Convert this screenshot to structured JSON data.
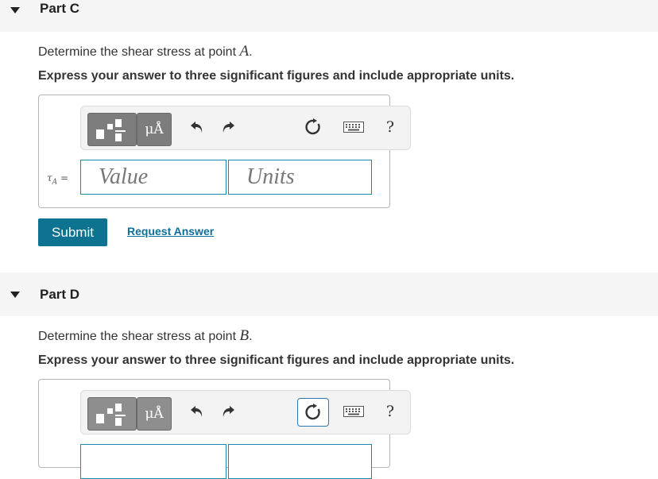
{
  "partC": {
    "title": "Part C",
    "question_prefix": "Determine the shear stress at point ",
    "question_var": "A",
    "question_suffix": ".",
    "instruction": "Express your answer to three significant figures and include appropriate units.",
    "answer_label_symbol": "τ",
    "answer_label_sub": "A",
    "answer_label_eq": " =",
    "value_placeholder": "Value",
    "units_placeholder": "Units",
    "submit_label": "Submit",
    "request_answer_label": "Request Answer"
  },
  "partD": {
    "title": "Part D",
    "question_prefix": "Determine the shear stress at point ",
    "question_var": "B",
    "question_suffix": ".",
    "instruction": "Express your answer to three significant figures and include appropriate units."
  },
  "toolbar": {
    "units_button_label": "μÅ",
    "help_label": "?",
    "icons": [
      "templates-icon",
      "units-icon",
      "undo-icon",
      "redo-icon",
      "reset-icon",
      "keyboard-icon",
      "help-icon"
    ]
  },
  "colors": {
    "accent": "#0d7391",
    "link": "#0e6f99",
    "header_bg": "#f5f5f5",
    "field_border": "#1a8ab0"
  }
}
